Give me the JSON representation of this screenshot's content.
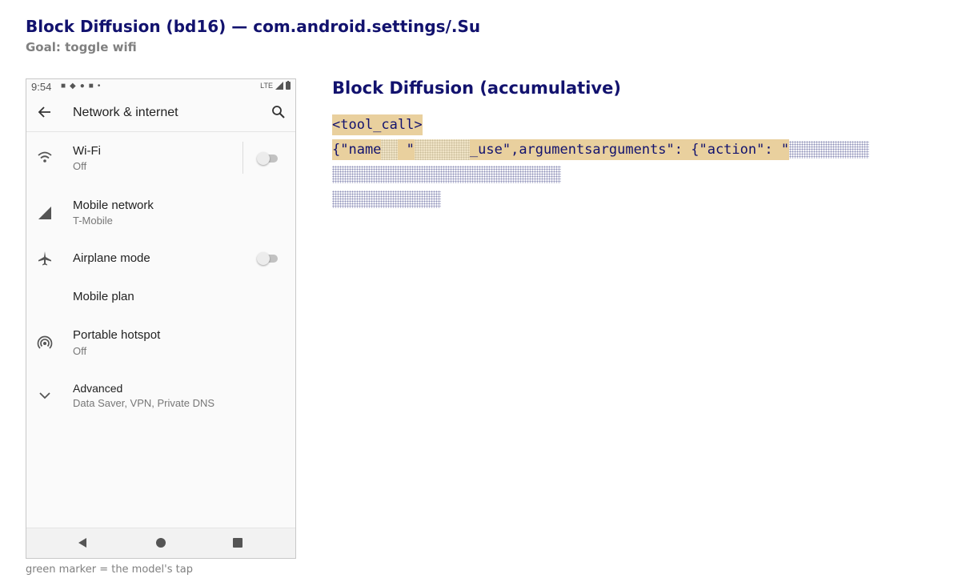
{
  "header": {
    "title": "Block Diffusion (bd16) — com.android.settings/.Su",
    "goal": "Goal: toggle wifi"
  },
  "phone": {
    "status_bar": {
      "time": "9:54",
      "network": "LTE"
    },
    "app_bar": {
      "title": "Network & internet"
    },
    "items": [
      {
        "label": "Wi-Fi",
        "sub": "Off",
        "icon": "wifi-icon",
        "toggle": "off"
      },
      {
        "label": "Mobile network",
        "sub": "T-Mobile",
        "icon": "signal-icon"
      },
      {
        "label": "Airplane mode",
        "sub": "",
        "icon": "airplane-icon",
        "toggle": "off"
      },
      {
        "label": "Mobile plan",
        "sub": "",
        "icon": ""
      },
      {
        "label": "Portable hotspot",
        "sub": "Off",
        "icon": "hotspot-icon"
      },
      {
        "label": "Advanced",
        "sub": "Data Saver, VPN, Private DNS",
        "icon": "chevron-down-icon"
      }
    ],
    "nav": [
      "back-icon",
      "home-icon",
      "recents-icon"
    ]
  },
  "caption": "green marker = the model's tap",
  "diffusion": {
    "title": "Block Diffusion (accumulative)",
    "tokens": {
      "tool_call": "<tool_call>",
      "name_key": "{\"name",
      "quote": " \"",
      "use_args": "_use\",argumentsarguments\": {\"action\": \""
    }
  },
  "colors": {
    "title": "#12126e",
    "filled_token": "#e9d09e",
    "masked_dots": "#8e90b8"
  }
}
